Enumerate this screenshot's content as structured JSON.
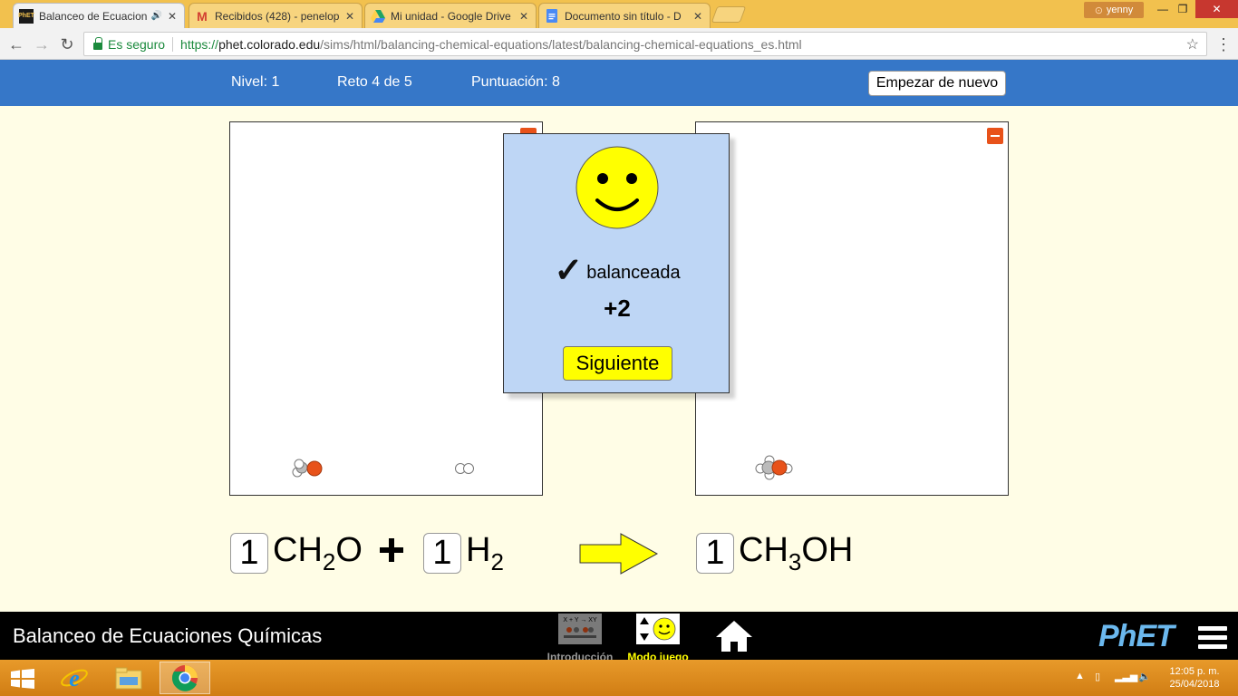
{
  "browser": {
    "tabs": [
      {
        "title": "Balanceo de Ecuacion",
        "icon": "phet-favicon",
        "active": true
      },
      {
        "title": "Recibidos (428) - penelop",
        "icon": "gmail-icon",
        "active": false
      },
      {
        "title": "Mi unidad - Google Drive",
        "icon": "google-drive-icon",
        "active": false
      },
      {
        "title": "Documento sin título - D",
        "icon": "google-docs-icon",
        "active": false
      }
    ],
    "user": "yenny",
    "secure_label": "Es seguro",
    "url_prefix": "https://",
    "url_host": "phet.colorado.edu",
    "url_path": "/sims/html/balancing-chemical-equations/latest/balancing-chemical-equations_es.html"
  },
  "sim_header": {
    "level": "Nivel: 1",
    "challenge": "Reto 4 de 5",
    "score": "Puntuación: 8",
    "restart_label": "Empezar de nuevo"
  },
  "popup": {
    "status": "balanceada",
    "checkmark": "✓",
    "points": "+2",
    "next_label": "Siguiente"
  },
  "equation": {
    "reactants": [
      {
        "coefficient": "1",
        "base": "CH",
        "sub1": "2",
        "tail": "O"
      },
      {
        "coefficient": "1",
        "base": "H",
        "sub1": "2",
        "tail": ""
      }
    ],
    "plus": "+",
    "products": [
      {
        "coefficient": "1",
        "base": "CH",
        "sub1": "3",
        "tail": "OH"
      }
    ]
  },
  "nav": {
    "sim_title": "Balanceo de Ecuaciones Químicas",
    "screens": [
      {
        "label": "Introducción",
        "selected": false,
        "thumb_text": "X + Y → XY"
      },
      {
        "label": "Modo juego",
        "selected": true
      }
    ],
    "logo": "PhET"
  },
  "taskbar": {
    "time": "12:05 p. m.",
    "date": "25/04/2018"
  },
  "colors": {
    "sim_header": "#3677c8",
    "background": "#fffde6",
    "popup": "#bed6f5",
    "next_button": "#ffff00",
    "collapse_button": "#e8521a",
    "oxygen": "#e8521a",
    "carbon": "#aaaaaa",
    "hydrogen": "#ffffff",
    "arrow": "#ffff00"
  }
}
